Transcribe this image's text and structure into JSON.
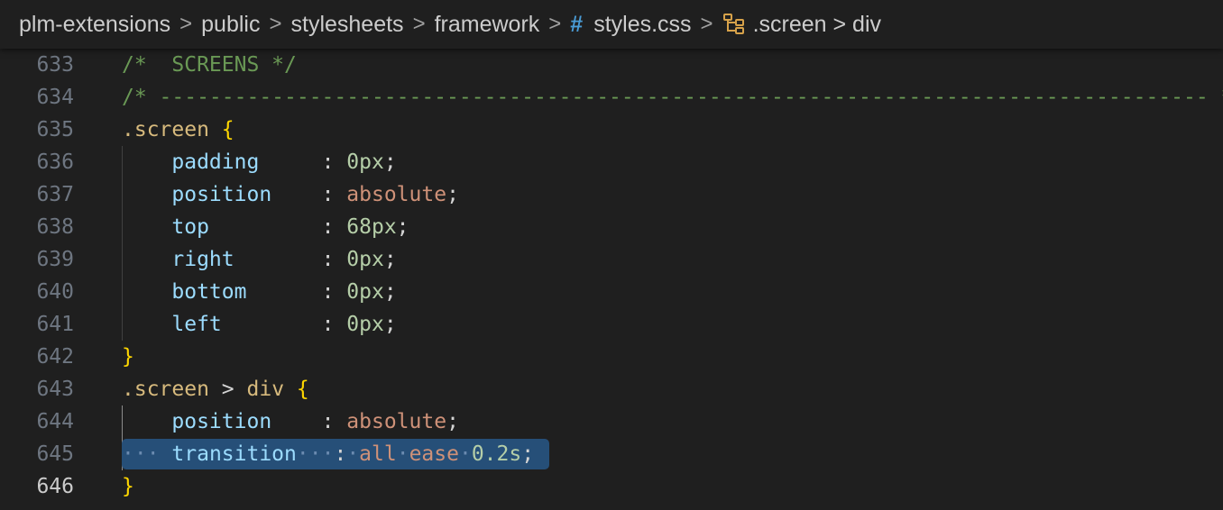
{
  "breadcrumb": {
    "items": [
      "plm-extensions",
      "public",
      "stylesheets",
      "framework"
    ],
    "separator": ">",
    "file_icon": "#",
    "file_name": "styles.css",
    "symbol_icon": "css-selector-icon",
    "symbol_name": ".screen > div"
  },
  "editor": {
    "lines": [
      {
        "num": "633",
        "c1": "/*  SCREENS */"
      },
      {
        "num": "634",
        "c1": "/* ------------------------------------------------------------------------------------ */"
      },
      {
        "num": "635",
        "sel": ".screen",
        "brace": "{"
      },
      {
        "num": "636",
        "prop": "padding",
        "colon": ":",
        "value": "0px",
        "semi": ";"
      },
      {
        "num": "637",
        "prop": "position",
        "colon": ":",
        "value": "absolute",
        "semi": ";"
      },
      {
        "num": "638",
        "prop": "top",
        "colon": ":",
        "value": "68px",
        "semi": ";"
      },
      {
        "num": "639",
        "prop": "right",
        "colon": ":",
        "value": "0px",
        "semi": ";"
      },
      {
        "num": "640",
        "prop": "bottom",
        "colon": ":",
        "value": "0px",
        "semi": ";"
      },
      {
        "num": "641",
        "prop": "left",
        "colon": ":",
        "value": "0px",
        "semi": ";"
      },
      {
        "num": "642",
        "brace": "}"
      },
      {
        "num": "643",
        "sel1": ".screen",
        "op": ">",
        "sel2": "div",
        "brace": "{"
      },
      {
        "num": "644",
        "prop": "position",
        "colon": ":",
        "value": "absolute",
        "semi": ";"
      },
      {
        "num": "645",
        "lead_ws": "···",
        "prop": "transition",
        "mid_ws": "··",
        "colon": ":",
        "v1": "all",
        "v2": "ease",
        "v3": "0.2s",
        "semi": ";"
      },
      {
        "num": "646",
        "brace": "}"
      }
    ]
  }
}
